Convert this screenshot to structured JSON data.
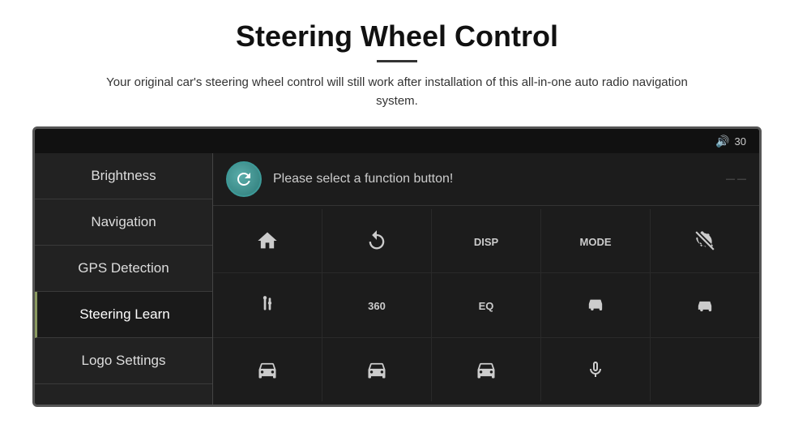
{
  "page": {
    "title": "Steering Wheel Control",
    "subtitle": "Your original car's steering wheel control will still work after installation of this all-in-one auto radio navigation system.",
    "divider": true
  },
  "topbar": {
    "volume_icon": "🔊",
    "volume_level": "30"
  },
  "sidebar": {
    "items": [
      {
        "id": "brightness",
        "label": "Brightness",
        "active": false
      },
      {
        "id": "navigation",
        "label": "Navigation",
        "active": false
      },
      {
        "id": "gps",
        "label": "GPS Detection",
        "active": false
      },
      {
        "id": "steering",
        "label": "Steering Learn",
        "active": true
      },
      {
        "id": "logo",
        "label": "Logo Settings",
        "active": false
      }
    ]
  },
  "content": {
    "prompt": "Please select a function button!",
    "refresh_label": "Refresh",
    "top_right_label": "...",
    "rows": [
      {
        "buttons": [
          {
            "id": "home",
            "icon": "home",
            "label": ""
          },
          {
            "id": "back",
            "icon": "back",
            "label": ""
          },
          {
            "id": "disp",
            "icon": "text",
            "label": "DISP"
          },
          {
            "id": "mode",
            "icon": "text",
            "label": "MODE"
          },
          {
            "id": "phone-slash",
            "icon": "phone-slash",
            "label": ""
          }
        ]
      },
      {
        "buttons": [
          {
            "id": "antenna",
            "icon": "antenna",
            "label": ""
          },
          {
            "id": "360",
            "icon": "text",
            "label": "360"
          },
          {
            "id": "eq",
            "icon": "text",
            "label": "EQ"
          },
          {
            "id": "car-front",
            "icon": "car",
            "label": ""
          },
          {
            "id": "car-back",
            "icon": "car2",
            "label": ""
          }
        ]
      },
      {
        "buttons": [
          {
            "id": "car3",
            "icon": "car3",
            "label": ""
          },
          {
            "id": "car4",
            "icon": "car2",
            "label": ""
          },
          {
            "id": "car5",
            "icon": "car3",
            "label": ""
          },
          {
            "id": "mic",
            "icon": "mic",
            "label": ""
          },
          {
            "id": "empty",
            "icon": "",
            "label": ""
          }
        ]
      }
    ]
  }
}
